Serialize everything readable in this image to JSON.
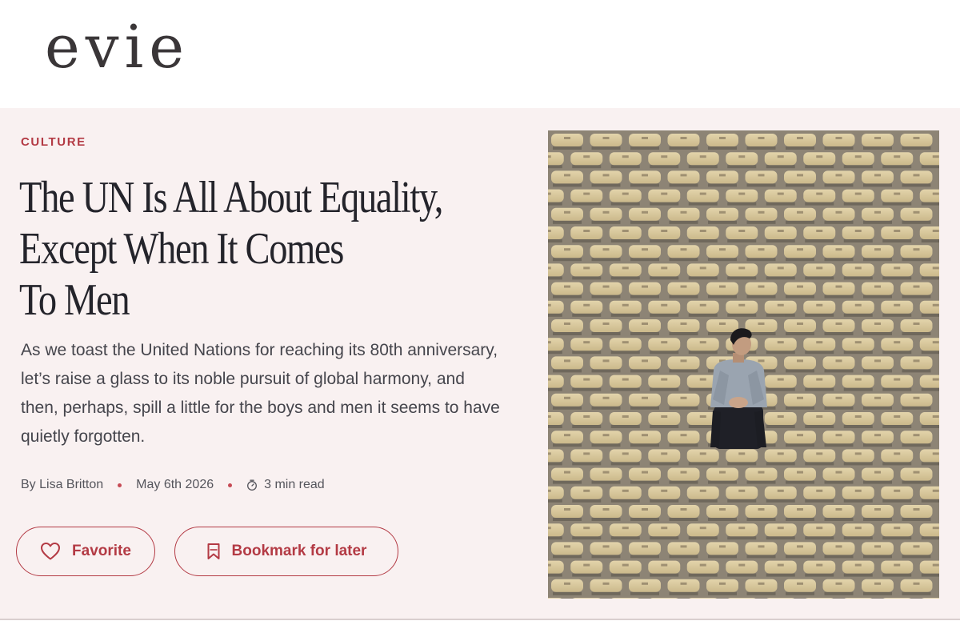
{
  "site": {
    "logo_text": "evie"
  },
  "article": {
    "category": "CULTURE",
    "headline_lines": [
      "The UN Is All About Equality,",
      "Except When It Comes",
      "To Men"
    ],
    "summary": "As we toast the United Nations for reaching its 80th anniversary, let’s raise a glass to its noble pursuit of global harmony, and then, perhaps, spill a little for the boys and men it seems to have quietly forgotten.",
    "byline": "By Lisa Britton",
    "date": "May 6th 2026",
    "read_time": "3 min read"
  },
  "actions": {
    "favorite_label": "Favorite",
    "bookmark_label": "Bookmark for later"
  },
  "icons": {
    "favorite": "heart-icon",
    "bookmark": "bookmark-icon",
    "read_time": "stopwatch-icon"
  },
  "colors": {
    "accent": "#b33a44",
    "hero_background": "#f9f1f1",
    "headline": "#24242b",
    "seat": "#dfcfa3"
  }
}
